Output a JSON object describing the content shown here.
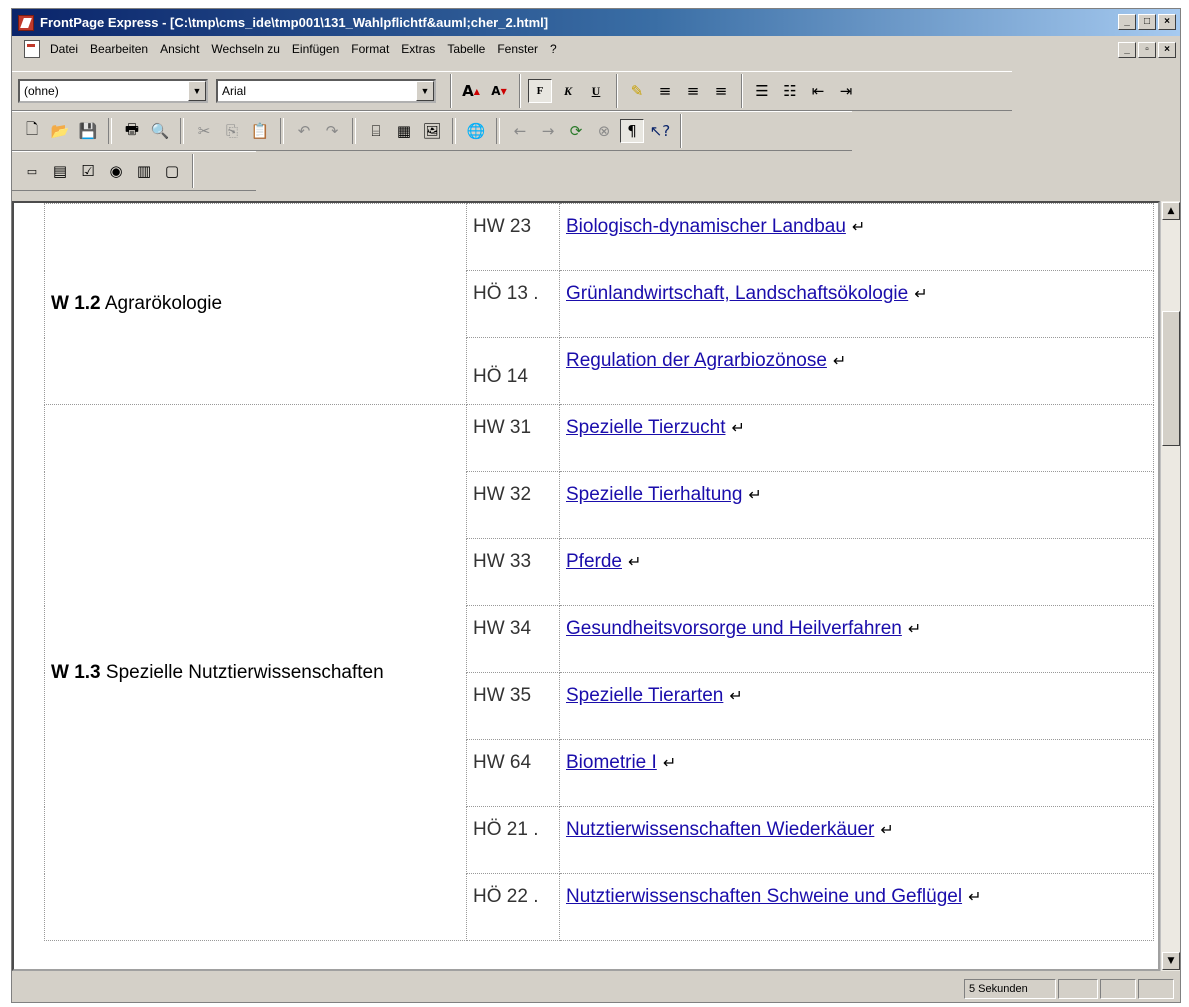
{
  "window": {
    "title": "FrontPage Express - [C:\\tmp\\cms_ide\\tmp001\\131_Wahlpflichtf&auml;cher_2.html]"
  },
  "menu": [
    "Datei",
    "Bearbeiten",
    "Ansicht",
    "Wechseln zu",
    "Einfügen",
    "Format",
    "Extras",
    "Tabelle",
    "Fenster",
    "?"
  ],
  "format_toolbar": {
    "style_value": "(ohne)",
    "font_value": "Arial"
  },
  "status": {
    "time": "5 Sekunden"
  },
  "rows": [
    {
      "code": "HW 23",
      "link": "Biologisch-dynamischer Landbau"
    },
    {
      "code": "HÖ 13 .",
      "link": "Grünlandwirtschaft, Landschaftsökologie"
    },
    {
      "code": "HÖ 14",
      "link": "Regulation der Agrarbiozönose"
    },
    {
      "code": "HW 31",
      "link": "Spezielle Tierzucht"
    },
    {
      "code": "HW 32",
      "link": "Spezielle Tierhaltung"
    },
    {
      "code": "HW 33",
      "link": "Pferde"
    },
    {
      "code": "HW 34",
      "link": "Gesundheitsvorsorge und Heilverfahren"
    },
    {
      "code": "HW 35",
      "link": "Spezielle Tierarten"
    },
    {
      "code": "HW 64",
      "link": "Biometrie I"
    },
    {
      "code": "HÖ 21 .",
      "link": "Nutztierwissenschaften Wiederkäuer"
    },
    {
      "code": "HÖ 22 .",
      "link": "Nutztierwissenschaften Schweine und Geflügel"
    }
  ],
  "categories": [
    {
      "bold": "W 1.2",
      "text": " Agrarökologie"
    },
    {
      "bold": "W 1.3",
      "text": " Spezielle Nutztierwissenschaften"
    }
  ],
  "colors": {
    "link": "#1a0dab",
    "titlebar": "#0a246a"
  }
}
